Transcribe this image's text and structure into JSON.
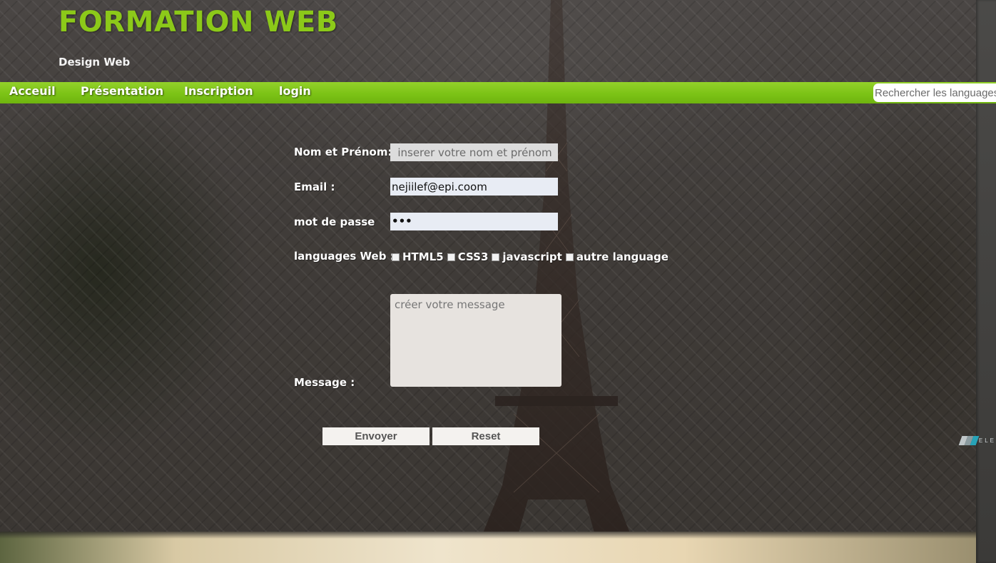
{
  "header": {
    "title": "FORMATION WEB",
    "subtitle": "Design Web"
  },
  "nav": {
    "items": [
      {
        "label": "Acceuil"
      },
      {
        "label": "Présentation"
      },
      {
        "label": "Inscription"
      },
      {
        "label": "login"
      }
    ],
    "search_placeholder": "Rechercher les languages"
  },
  "form": {
    "name_label": "Nom et Prénom:",
    "name_placeholder": "inserer votre nom et prénom",
    "name_value": "",
    "email_label": "Email :",
    "email_value": "nejiilef@epi.coom",
    "password_label": "mot de passe",
    "password_value": "•••",
    "languages_label": "languages Web :",
    "languages": [
      {
        "label": "HTML5",
        "checked": false
      },
      {
        "label": "CSS3",
        "checked": false
      },
      {
        "label": "javascript",
        "checked": false
      },
      {
        "label": "autre language",
        "checked": false
      }
    ],
    "message_label": "Message :",
    "message_placeholder": "créer votre message",
    "submit_label": "Envoyer",
    "reset_label": "Reset"
  },
  "badge": {
    "text": "ELE"
  },
  "colors": {
    "title_green": "#8cc919",
    "nav_green": "#7cc316"
  }
}
